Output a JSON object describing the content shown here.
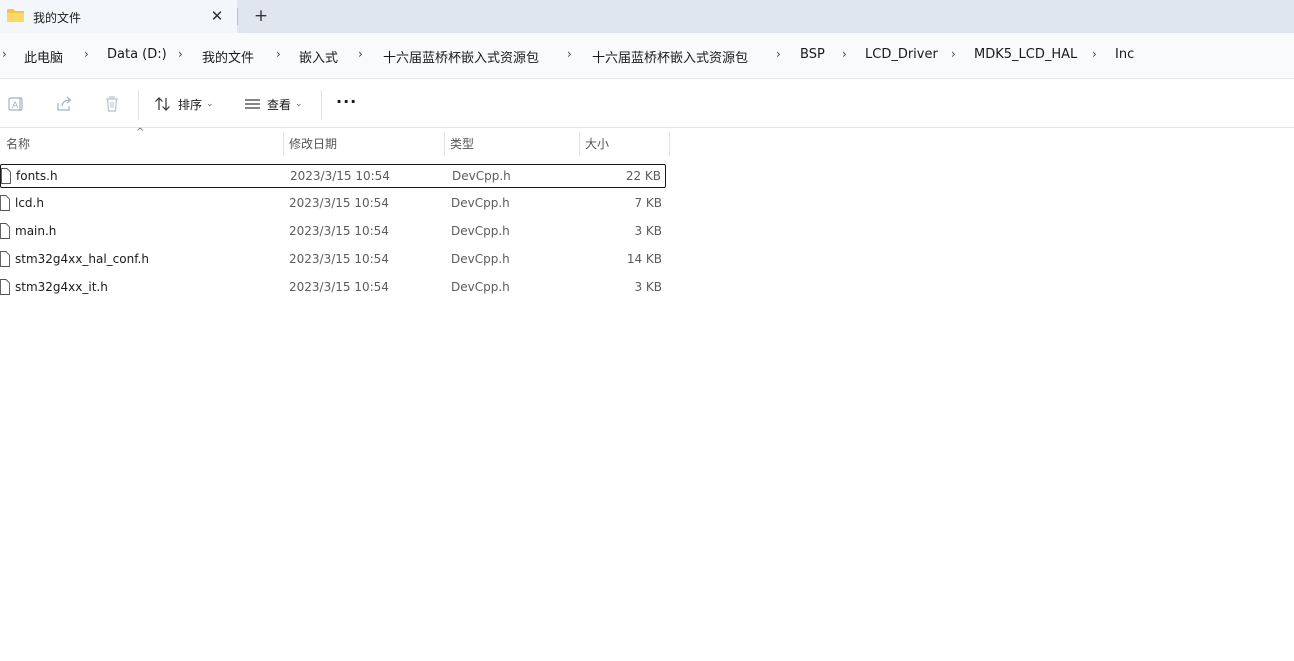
{
  "tab": {
    "title": "我的文件",
    "close_glyph": "✕",
    "new_tab_glyph": "+"
  },
  "breadcrumb": [
    "此电脑",
    "Data (D:)",
    "我的文件",
    "嵌入式",
    "十六届蓝桥杯嵌入式资源包",
    "十六届蓝桥杯嵌入式资源包",
    "BSP",
    "LCD_Driver",
    "MDK5_LCD_HAL",
    "Inc"
  ],
  "toolbar": {
    "rename_icon": "rename-icon",
    "share_icon": "share-icon",
    "delete_icon": "trash-icon",
    "sort_label": "排序",
    "view_label": "查看",
    "more_glyph": "···"
  },
  "columns": {
    "name": "名称",
    "date": "修改日期",
    "type": "类型",
    "size": "大小"
  },
  "files": [
    {
      "name": "fonts.h",
      "date": "2023/3/15 10:54",
      "type": "DevCpp.h",
      "size": "22 KB"
    },
    {
      "name": "lcd.h",
      "date": "2023/3/15 10:54",
      "type": "DevCpp.h",
      "size": "7 KB"
    },
    {
      "name": "main.h",
      "date": "2023/3/15 10:54",
      "type": "DevCpp.h",
      "size": "3 KB"
    },
    {
      "name": "stm32g4xx_hal_conf.h",
      "date": "2023/3/15 10:54",
      "type": "DevCpp.h",
      "size": "14 KB"
    },
    {
      "name": "stm32g4xx_it.h",
      "date": "2023/3/15 10:54",
      "type": "DevCpp.h",
      "size": "3 KB"
    }
  ],
  "colors": {
    "titlebar_bg": "#dfe6ef",
    "tab_bg": "#f3f6fa",
    "folder_yellow": "#f5c542"
  }
}
